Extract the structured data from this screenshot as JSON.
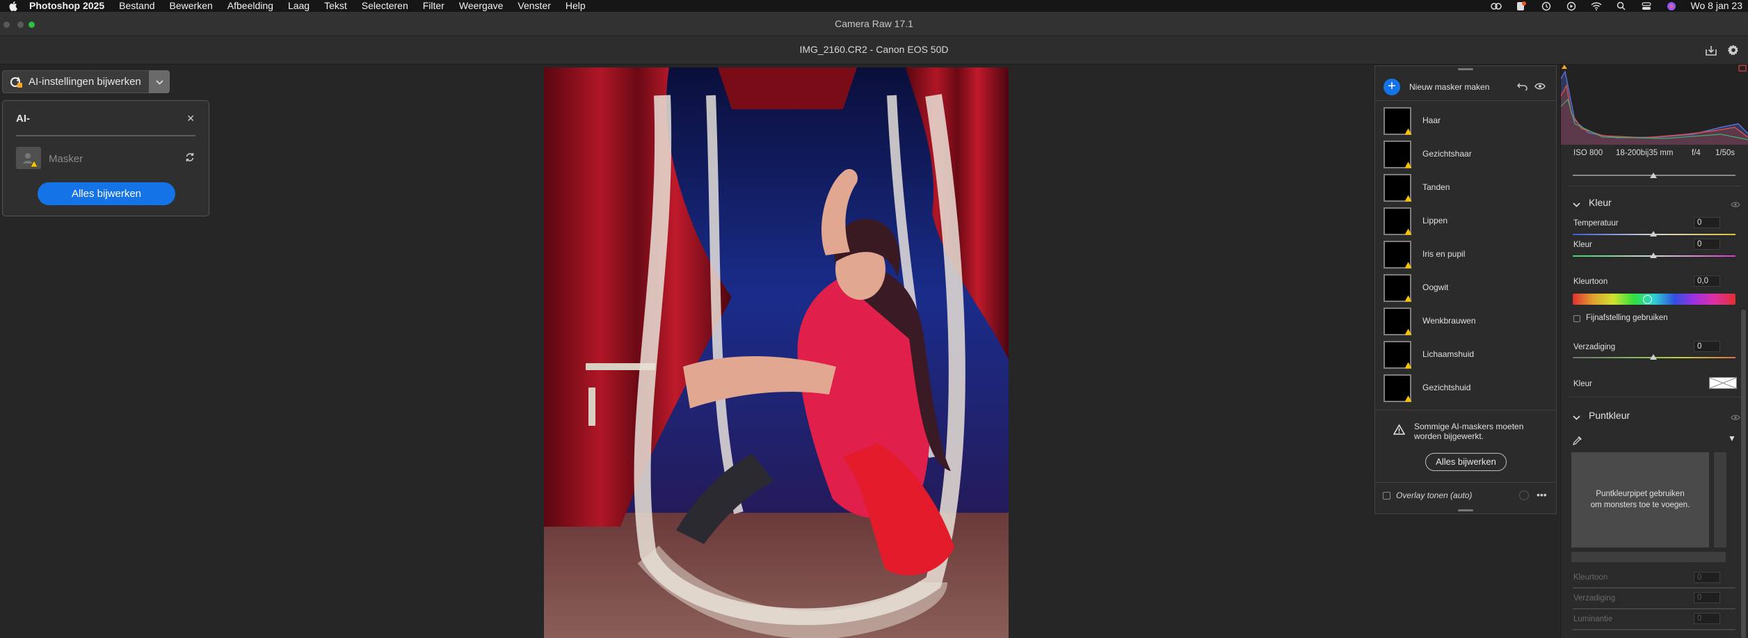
{
  "menubar": {
    "app": "Photoshop 2025",
    "items": [
      "Bestand",
      "Bewerken",
      "Afbeelding",
      "Laag",
      "Tekst",
      "Selecteren",
      "Filter",
      "Weergave",
      "Venster",
      "Help"
    ],
    "clock": "Wo 8 jan 23"
  },
  "window": {
    "title": "Camera Raw 17.1"
  },
  "file": {
    "name": "IMG_2160.CR2  -  Canon EOS 50D"
  },
  "ai_update": {
    "button_label": "AI-instellingen bijwerken",
    "panel_title": "AI-",
    "mask_label": "Masker",
    "update_all_label": "Alles bijwerken"
  },
  "masks": {
    "new_mask_label": "Nieuw masker maken",
    "items": [
      {
        "label": "Haar"
      },
      {
        "label": "Gezichtshaar"
      },
      {
        "label": "Tanden"
      },
      {
        "label": "Lippen"
      },
      {
        "label": "Iris en pupil"
      },
      {
        "label": "Oogwit"
      },
      {
        "label": "Wenkbrauwen"
      },
      {
        "label": "Lichaamshuid"
      },
      {
        "label": "Gezichtshuid"
      }
    ],
    "notice_line1": "Sommige AI-maskers moeten",
    "notice_line2": "worden bijgewerkt.",
    "update_all_label": "Alles bijwerken",
    "overlay_label": "Overlay tonen (auto)"
  },
  "camera": {
    "iso": "ISO 800",
    "lens": "18-200bij35 mm",
    "aperture": "f/4",
    "shutter": "1/50s"
  },
  "color_section": {
    "title": "Kleur",
    "temperature_label": "Temperatuur",
    "temperature_value": "0",
    "tint_label": "Kleur",
    "tint_value": "0",
    "hue_label": "Kleurtoon",
    "hue_value": "0,0",
    "fine_label": "Fijnafstelling gebruiken",
    "saturation_label": "Verzadiging",
    "saturation_value": "0",
    "color_label": "Kleur"
  },
  "point_color": {
    "title": "Puntkleur",
    "hint_line1": "Puntkleurpipet gebruiken",
    "hint_line2": "om monsters toe te voegen.",
    "hue_label": "Kleurtoon",
    "saturation_label": "Verzadiging",
    "luminance_label": "Luminantie",
    "value": "0"
  }
}
